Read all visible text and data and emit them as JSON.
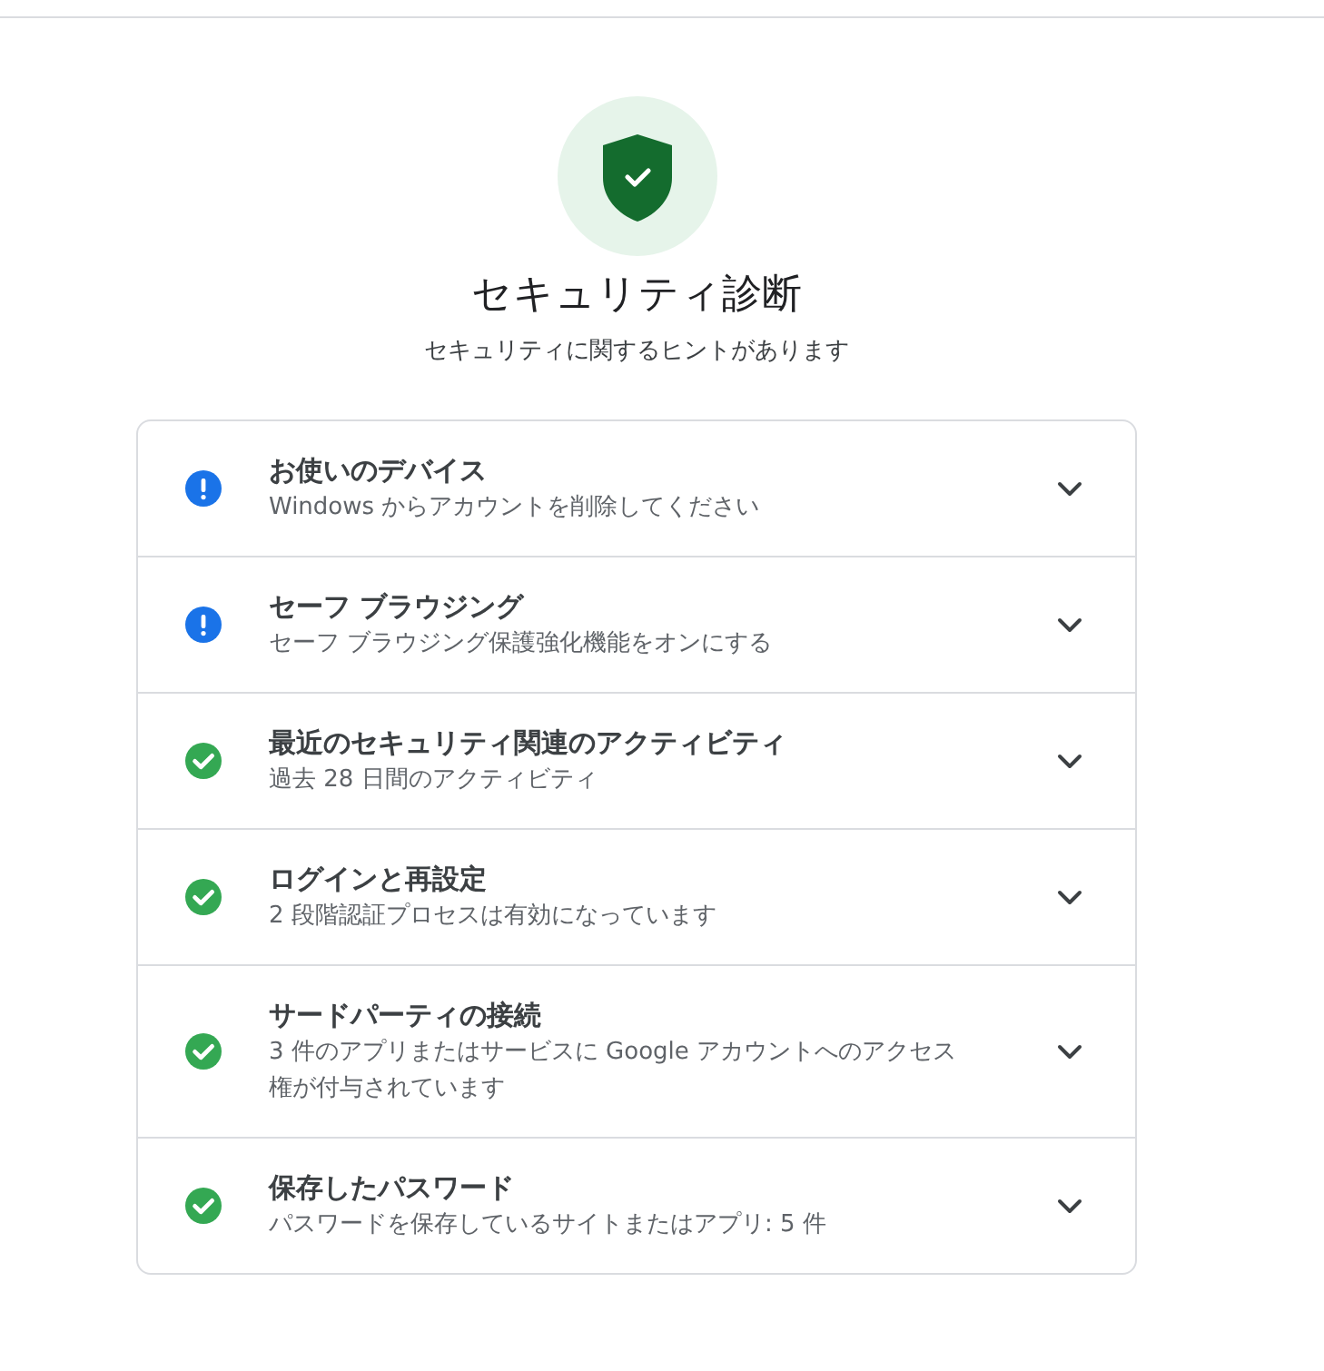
{
  "header": {
    "title": "セキュリティ診断",
    "subtitle": "セキュリティに関するヒントがあります"
  },
  "items": [
    {
      "kind": "warning",
      "title": "お使いのデバイス",
      "description": "Windows からアカウントを削除してください",
      "expanded": false
    },
    {
      "kind": "warning",
      "title": "セーフ ブラウジング",
      "description": "セーフ ブラウジング保護強化機能をオンにする",
      "expanded": false
    },
    {
      "kind": "ok",
      "title": "最近のセキュリティ関連のアクティビティ",
      "description": "過去 28 日間のアクティビティ",
      "expanded": false
    },
    {
      "kind": "ok",
      "title": "ログインと再設定",
      "description": "2 段階認証プロセスは有効になっています",
      "expanded": false
    },
    {
      "kind": "ok",
      "title": "サードパーティの接続",
      "description": "3 件のアプリまたはサービスに Google アカウントへのアクセス権が付与されています",
      "expanded": false
    },
    {
      "kind": "ok",
      "title": "保存したパスワード",
      "description": "パスワードを保存しているサイトまたはアプリ: 5 件",
      "expanded": false
    }
  ]
}
